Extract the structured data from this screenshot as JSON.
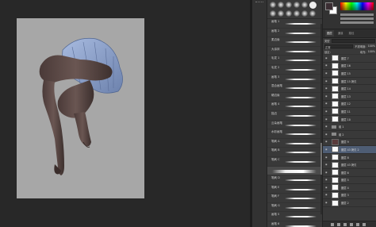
{
  "brushes": {
    "names": [
      "画笔 1",
      "画笔 2",
      "柔边缘",
      "大涂抹",
      "毛发 1",
      "毛发 2",
      "画笔 3",
      "混合画笔",
      "硬边缘",
      "画笔 4",
      "描边",
      "云朵画笔",
      "水彩画笔",
      "笔刷 A",
      "笔刷 B",
      "笔刷 C",
      "笔刷 D",
      "笔刷 E",
      "笔刷 F",
      "笔刷 G",
      "画笔 5",
      "画笔 6",
      "画笔 7",
      "画笔 8"
    ]
  },
  "color": {
    "foreground": "#3b2e33",
    "background": "#ffffff"
  },
  "layers_panel": {
    "tabs": [
      "图层",
      "通道",
      "路径"
    ],
    "kind_label": "类型",
    "blend_mode": "正常",
    "opacity_label": "不透明度:",
    "opacity_value": "100%",
    "lock_label": "锁定:",
    "fill_label": "填充:",
    "fill_value": "100%",
    "layers": [
      {
        "name": "图层 7",
        "type": "layer",
        "active": false
      },
      {
        "name": "图层 16",
        "type": "layer",
        "active": false
      },
      {
        "name": "图层 15",
        "type": "layer",
        "active": false
      },
      {
        "name": "图层 15 拷贝",
        "type": "layer",
        "active": false
      },
      {
        "name": "图层 14",
        "type": "layer",
        "active": false
      },
      {
        "name": "图层 13",
        "type": "layer",
        "active": false
      },
      {
        "name": "图层 12",
        "type": "layer",
        "active": false
      },
      {
        "name": "图层 11",
        "type": "layer",
        "active": false
      },
      {
        "name": "图层 10",
        "type": "layer",
        "active": false
      },
      {
        "name": "组 1",
        "type": "group",
        "active": false
      },
      {
        "name": "组 2",
        "type": "group",
        "active": false
      },
      {
        "name": "图层 9",
        "type": "layer",
        "active": false
      },
      {
        "name": "图层 43 拷贝 2",
        "type": "layer",
        "active": true
      },
      {
        "name": "图层 8",
        "type": "layer",
        "active": false
      },
      {
        "name": "图层 43 拷贝",
        "type": "layer",
        "active": false
      },
      {
        "name": "图层 6",
        "type": "layer",
        "active": false
      },
      {
        "name": "图层 5",
        "type": "layer",
        "active": false
      },
      {
        "name": "图层 4",
        "type": "layer",
        "active": false
      },
      {
        "name": "图层 3",
        "type": "layer",
        "active": false
      },
      {
        "name": "图层 2",
        "type": "layer",
        "active": false
      }
    ]
  }
}
